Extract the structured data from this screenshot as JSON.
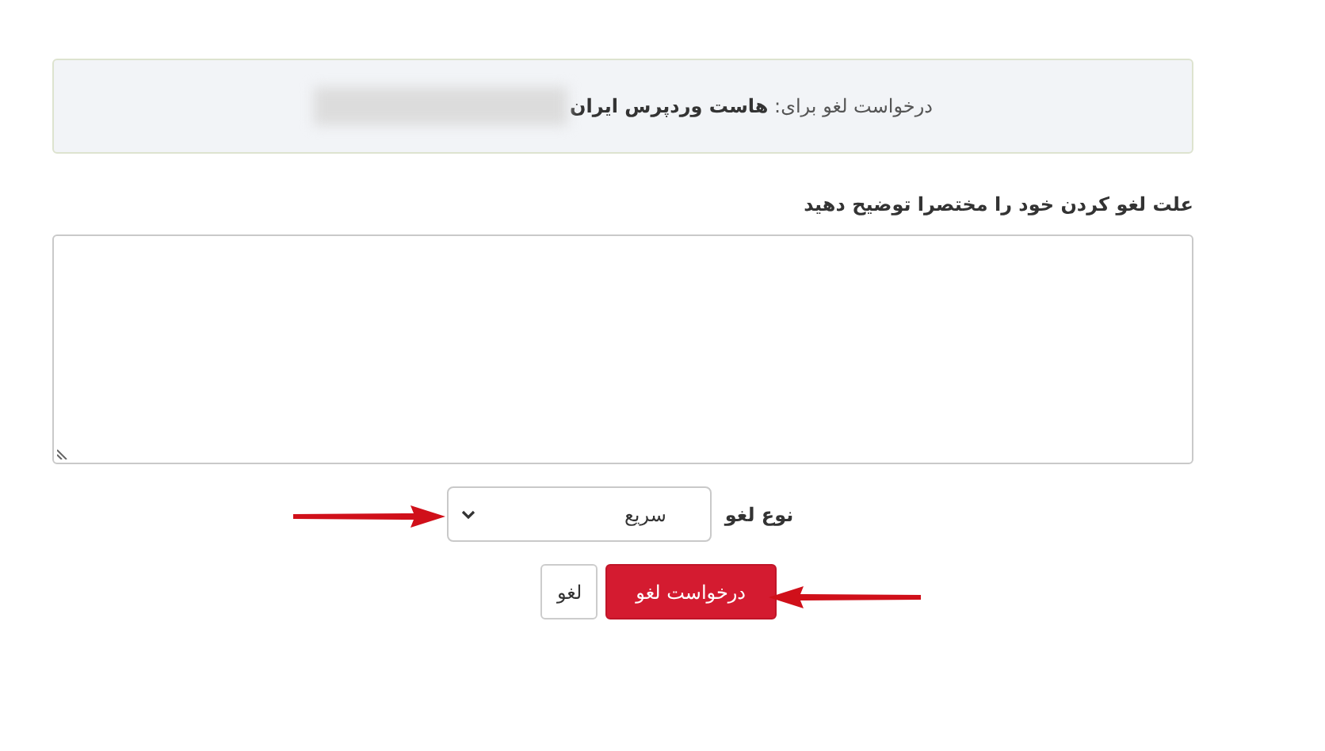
{
  "notice": {
    "text": "درخواست لغو برای: **هاست وردپرس ایران**"
  },
  "reason": {
    "label": "علت لغو کردن خود را مختصرا توضیح دهید"
  },
  "cancel_type": {
    "label": "نوع لغو",
    "value": "سریع"
  },
  "buttons": [
    {
      "label": "درخواست لغو",
      "kind": "primary"
    },
    {
      "label": "لغو",
      "kind": "secondary"
    }
  ]
}
